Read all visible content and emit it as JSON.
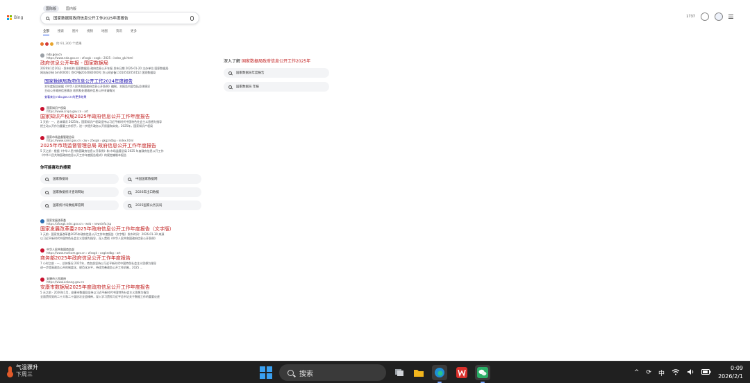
{
  "header": {
    "logo_text": "Bing",
    "scope_tabs": [
      "国际版",
      "国内版"
    ],
    "search_query": "国家数据局政府信息公开工作2025年度报告",
    "nav_tabs": [
      "全部",
      "搜索",
      "图片",
      "视频",
      "地图",
      "资讯",
      "更多"
    ],
    "rewards_points": "1737"
  },
  "results": {
    "count": "约 91,300 个结果",
    "items": [
      {
        "site": "nda.gov.cn",
        "url": "https://www.nda.gov.cn › zfxxgk › xxgk › 2025 › index_gk.html",
        "title": "政府信息公开年报 - 国家数据局",
        "snippet": "2026年1月20日 · 发布机构 国家数据局 政府信息公开年报 发布日期 2026-01-20 主办单位 国家数据局",
        "snippet2": "网站标识码 bm000001 京ICP备2024082000号 京公网安备11010502050152 国家数据局",
        "sublink_title": "国家数据局政府信息公开工作2024年度报告",
        "sublink_snippet": "本年度报告依据《中华人民共和国政府信息公开条例》编制，本报告内容包括总体情况",
        "sublink_snippet2": "主动公开政府信息情况 收到和处理政府信息公开申请情况",
        "more": "查看来自 nda.gov.cn 的更多结果"
      },
      {
        "site": "国家知识产权局",
        "url": "https://www.cnipa.gov.cn › art",
        "title": "国家知识产权局2025年政府信息公开工作年度报告",
        "snippet": "1 天前 · 一、总体情况 2025年，国家知识产权局坚持以习近平新时代中国特色社会主义思想为指导",
        "snippet2": "把主动公开作为重要工作抓手，进一步提升政务公开质量和实效，2025年，国家知识产权局"
      },
      {
        "site": "国家市场监督管理总局",
        "url": "https://www.samr.gov.cn › zw › zfxxgk › gkgzndbg › index.html",
        "title": "2025年市场监督管理总局 政府信息公开工作年度报告",
        "snippet": "5 天之前 · 根据《中华人民共和国政府信息公开条例》和 市场监管总局 2025 年度政府信息公开工作",
        "snippet2": "《中华人民共和国政府信息公开工作年度报告格式》的规定编制本报告"
      }
    ],
    "related_heading": "你可能喜欢的搜索",
    "related": [
      "国家数据局",
      "中国国家数据网",
      "国家数据统计查询网站",
      "2026年出口数据",
      "国家统计局数据库官网",
      "2025国家公务员局"
    ],
    "items2": [
      {
        "site": "国家发展改革委",
        "url": "https://zfxxgk.ndrc.gov.cn › web › newsinfo.jsp",
        "title": "国家发展改革委2025年政府信息公开工作年度报告（文字版）",
        "snippet": "1 天前 · 国家发展改革委2025年政府信息公开工作年度报告（文字版）发布时间：2026-01-30 来源",
        "snippet2": "以习近平新时代中国特色社会主义思想为指导，深入贯彻《中华人民共和国政府信息公开条例》"
      },
      {
        "site": "中华人民共和国商务部",
        "url": "https://www.mofcom.gov.cn › zfxxgk › xxgkndbg › art",
        "title": "商务部2025年政府信息公开工作年度报告",
        "snippet": "7 小时之前 · 一、总体情况 2025年，商务部坚持以习近平新时代中国特色社会主义思想为指导",
        "snippet2": "进一步提高政务公开的制度化、规范化水平，持续完善政务公开工作机制，2025 ..."
      },
      {
        "site": "安康市人民政府",
        "url": "https://www.ankang.gov.cn",
        "title": "安康市数据局2025年度政府信息公开工作年度报告",
        "snippet": "5 天之前 · 2026年1月，安康市数据局坚持以习近平新时代中国特色社会主义思想为指导",
        "snippet2": "全面贯彻党的二十大和二十届历次全会精神，深入学习贯彻习近平总书记关于数据工作的重要论述"
      }
    ]
  },
  "panel": {
    "prefix": "深入了解",
    "topic": "国家数据局政府信息公开工作2025年",
    "chips": [
      "国家数据局年度报告",
      "国家数据局 年报"
    ]
  },
  "taskbar": {
    "weather_title": "气温骤升",
    "weather_sub": "下周三",
    "search_label": "搜索",
    "ime": "中",
    "time": "0:09",
    "date": "2026/2/1"
  },
  "colors": {
    "link": "#1a0dab",
    "red_title": "#c11c1c",
    "taskbar": "#202020",
    "accent": "#174ae4"
  }
}
